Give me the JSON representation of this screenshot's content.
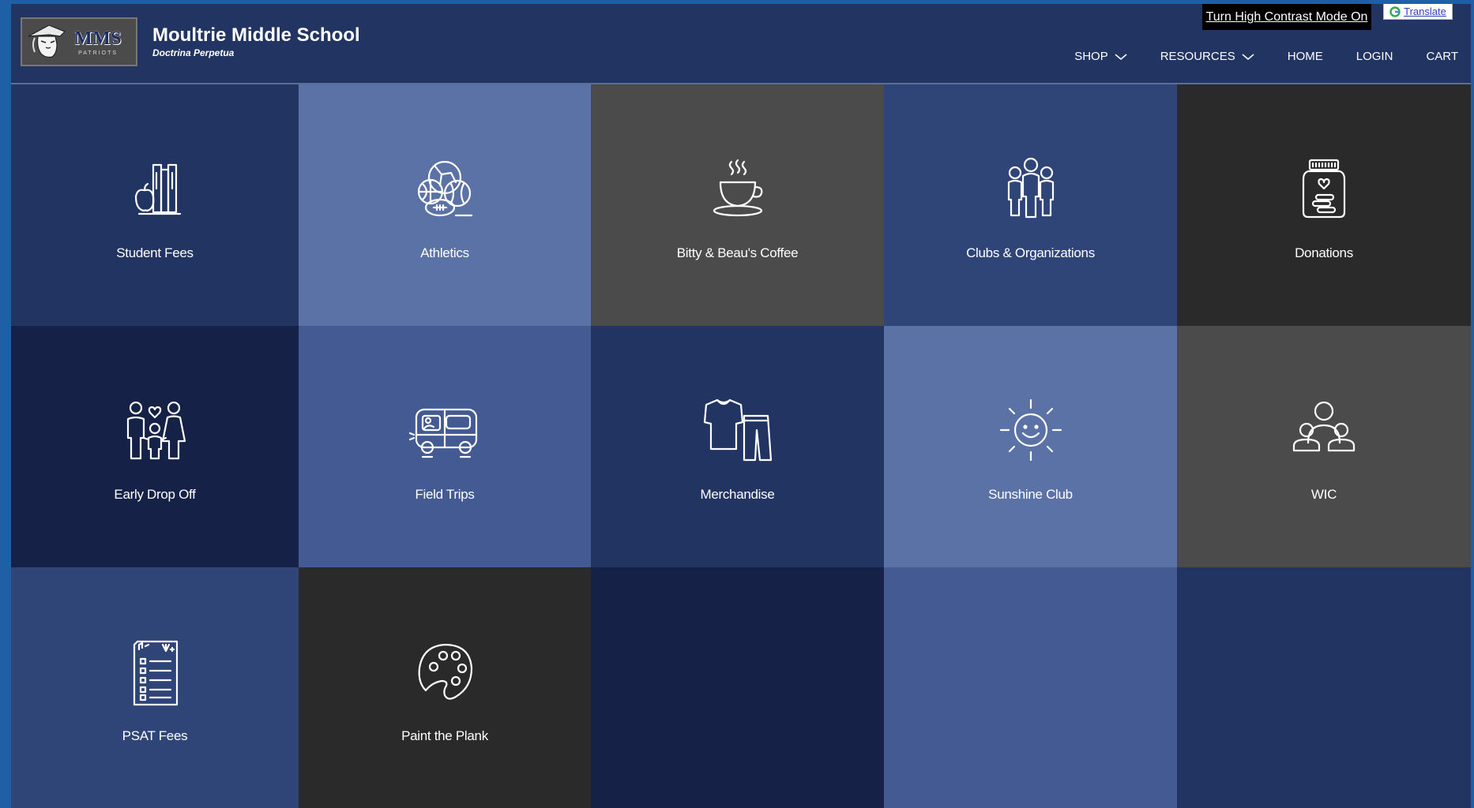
{
  "header": {
    "logo": {
      "text": "MMS",
      "subtext": "PATRIOTS"
    },
    "school_name": "Moultrie Middle School",
    "motto": "Doctrina Perpetua",
    "contrast_button": "Turn High Contrast Mode On",
    "translate_button": "Translate"
  },
  "nav": {
    "items": [
      {
        "label": "SHOP",
        "has_dropdown": true
      },
      {
        "label": "RESOURCES",
        "has_dropdown": true
      },
      {
        "label": "HOME",
        "has_dropdown": false
      },
      {
        "label": "LOGIN",
        "has_dropdown": false
      },
      {
        "label": "CART",
        "has_dropdown": false
      }
    ]
  },
  "tiles": [
    {
      "label": "Student Fees",
      "icon": "books-apple-icon",
      "color": "#223462"
    },
    {
      "label": "Athletics",
      "icon": "sports-balls-icon",
      "color": "#5b72a7"
    },
    {
      "label": "Bitty & Beau's Coffee",
      "icon": "coffee-cup-icon",
      "color": "#4b4b4b"
    },
    {
      "label": "Clubs & Organizations",
      "icon": "people-group-icon",
      "color": "#2f4578"
    },
    {
      "label": "Donations",
      "icon": "donation-jar-icon",
      "color": "#2a2a2a"
    },
    {
      "label": "Early Drop Off",
      "icon": "family-icon",
      "color": "#162147"
    },
    {
      "label": "Field Trips",
      "icon": "bus-icon",
      "color": "#435a92"
    },
    {
      "label": "Merchandise",
      "icon": "shirt-pants-icon",
      "color": "#223462"
    },
    {
      "label": "Sunshine Club",
      "icon": "sun-icon",
      "color": "#5b72a7"
    },
    {
      "label": "WIC",
      "icon": "group-icon",
      "color": "#4b4b4b"
    },
    {
      "label": "PSAT Fees",
      "icon": "checklist-icon",
      "color": "#2f4578"
    },
    {
      "label": "Paint the Plank",
      "icon": "paint-palette-icon",
      "color": "#2a2a2a"
    },
    {
      "label": "",
      "icon": "",
      "color": "#162147"
    },
    {
      "label": "",
      "icon": "",
      "color": "#435a92"
    },
    {
      "label": "",
      "icon": "",
      "color": "#223462"
    }
  ]
}
